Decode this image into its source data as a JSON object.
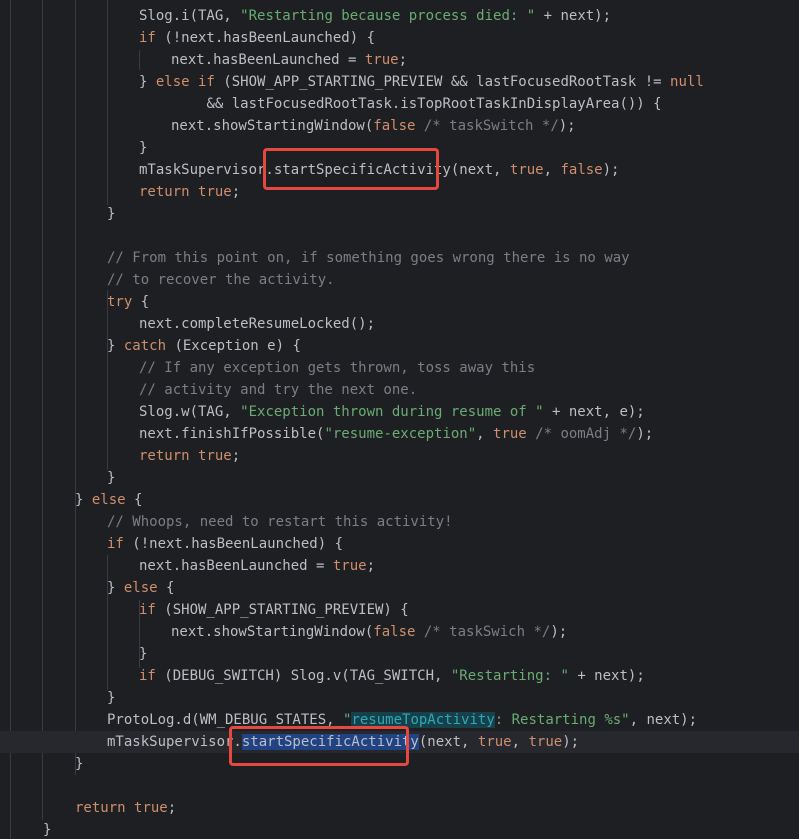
{
  "editor": {
    "lines": [
      {
        "indent": 2,
        "segs": [
          [
            "Slog.i(TAG, ",
            "plain"
          ],
          [
            "\"Restarting because process died: \"",
            "str"
          ],
          [
            " + next);",
            "plain"
          ]
        ]
      },
      {
        "indent": 2,
        "segs": [
          [
            "if",
            "kw"
          ],
          [
            " (!next.hasBeenLaunched) {",
            "plain"
          ]
        ]
      },
      {
        "indent": 3,
        "segs": [
          [
            "next.hasBeenLaunched = ",
            "plain"
          ],
          [
            "true",
            "kw"
          ],
          [
            ";",
            "plain"
          ]
        ]
      },
      {
        "indent": 2,
        "segs": [
          [
            "} ",
            "plain"
          ],
          [
            "else if",
            "kw"
          ],
          [
            " (SHOW_APP_STARTING_PREVIEW && lastFocusedRootTask != ",
            "plain"
          ],
          [
            "null",
            "kw"
          ]
        ]
      },
      {
        "indent": 2,
        "pad": "        ",
        "segs": [
          [
            "&& lastFocusedRootTask.isTopRootTaskInDisplayArea()) {",
            "plain"
          ]
        ]
      },
      {
        "indent": 3,
        "segs": [
          [
            "next.showStartingWindow(",
            "plain"
          ],
          [
            "false",
            "kw"
          ],
          [
            " /* taskSwitch */",
            "cm"
          ],
          [
            ");",
            "plain"
          ]
        ]
      },
      {
        "indent": 2,
        "segs": [
          [
            "}",
            "plain"
          ]
        ]
      },
      {
        "indent": 2,
        "segs": [
          [
            "mTaskSupervisor.",
            "plain"
          ],
          [
            "startSpecificActivity",
            "plain"
          ],
          [
            "(next, ",
            "plain"
          ],
          [
            "true",
            "kw"
          ],
          [
            ", ",
            "plain"
          ],
          [
            "false",
            "kw"
          ],
          [
            ");",
            "plain"
          ]
        ]
      },
      {
        "indent": 2,
        "segs": [
          [
            "return",
            "kw"
          ],
          [
            " ",
            "plain"
          ],
          [
            "true",
            "kw"
          ],
          [
            ";",
            "plain"
          ]
        ]
      },
      {
        "indent": 1,
        "segs": [
          [
            "}",
            "plain"
          ]
        ]
      },
      {
        "indent": 0,
        "segs": []
      },
      {
        "indent": 1,
        "segs": [
          [
            "// From this point on, if something goes wrong there is no way",
            "cm"
          ]
        ]
      },
      {
        "indent": 1,
        "segs": [
          [
            "// to recover the activity.",
            "cm"
          ]
        ]
      },
      {
        "indent": 1,
        "segs": [
          [
            "try",
            "kw"
          ],
          [
            " {",
            "plain"
          ]
        ]
      },
      {
        "indent": 2,
        "segs": [
          [
            "next.completeResumeLocked();",
            "plain"
          ]
        ]
      },
      {
        "indent": 1,
        "segs": [
          [
            "} ",
            "plain"
          ],
          [
            "catch",
            "kw"
          ],
          [
            " (Exception e) {",
            "plain"
          ]
        ]
      },
      {
        "indent": 2,
        "segs": [
          [
            "// If any exception gets thrown, toss away this",
            "cm"
          ]
        ]
      },
      {
        "indent": 2,
        "segs": [
          [
            "// activity and try the next one.",
            "cm"
          ]
        ]
      },
      {
        "indent": 2,
        "segs": [
          [
            "Slog.w(TAG, ",
            "plain"
          ],
          [
            "\"Exception thrown during resume of \"",
            "str"
          ],
          [
            " + next, e);",
            "plain"
          ]
        ]
      },
      {
        "indent": 2,
        "segs": [
          [
            "next.finishIfPossible(",
            "plain"
          ],
          [
            "\"resume-exception\"",
            "str"
          ],
          [
            ", ",
            "plain"
          ],
          [
            "true",
            "kw"
          ],
          [
            " /* oomAdj */",
            "cm"
          ],
          [
            ");",
            "plain"
          ]
        ]
      },
      {
        "indent": 2,
        "segs": [
          [
            "return",
            "kw"
          ],
          [
            " ",
            "plain"
          ],
          [
            "true",
            "kw"
          ],
          [
            ";",
            "plain"
          ]
        ]
      },
      {
        "indent": 1,
        "segs": [
          [
            "}",
            "plain"
          ]
        ]
      },
      {
        "indent": 0,
        "segs": [
          [
            "} ",
            "plain"
          ],
          [
            "else",
            "kw"
          ],
          [
            " {",
            "plain"
          ]
        ]
      },
      {
        "indent": 1,
        "segs": [
          [
            "// Whoops, need to restart this activity!",
            "cm"
          ]
        ]
      },
      {
        "indent": 1,
        "segs": [
          [
            "if",
            "kw"
          ],
          [
            " (!next.hasBeenLaunched) {",
            "plain"
          ]
        ]
      },
      {
        "indent": 2,
        "segs": [
          [
            "next.hasBeenLaunched = ",
            "plain"
          ],
          [
            "true",
            "kw"
          ],
          [
            ";",
            "plain"
          ]
        ]
      },
      {
        "indent": 1,
        "segs": [
          [
            "} ",
            "plain"
          ],
          [
            "else",
            "kw"
          ],
          [
            " {",
            "plain"
          ]
        ]
      },
      {
        "indent": 2,
        "segs": [
          [
            "if",
            "kw"
          ],
          [
            " (SHOW_APP_STARTING_PREVIEW) {",
            "plain"
          ]
        ]
      },
      {
        "indent": 3,
        "segs": [
          [
            "next.showStartingWindow(",
            "plain"
          ],
          [
            "false",
            "kw"
          ],
          [
            " /* taskSwich */",
            "cm"
          ],
          [
            ");",
            "plain"
          ]
        ]
      },
      {
        "indent": 2,
        "segs": [
          [
            "}",
            "plain"
          ]
        ]
      },
      {
        "indent": 2,
        "segs": [
          [
            "if",
            "kw"
          ],
          [
            " (DEBUG_SWITCH) Slog.v(TAG_SWITCH, ",
            "plain"
          ],
          [
            "\"Restarting: \"",
            "str"
          ],
          [
            " + next);",
            "plain"
          ]
        ]
      },
      {
        "indent": 1,
        "segs": [
          [
            "}",
            "plain"
          ]
        ]
      },
      {
        "indent": 1,
        "segs": [
          [
            "ProtoLog.d(WM_DEBUG_STATES, ",
            "plain"
          ],
          [
            "\"",
            "str"
          ],
          [
            "resumeTopActivity",
            "hl-tpl"
          ],
          [
            ": Restarting %s\"",
            "str"
          ],
          [
            ", next);",
            "plain"
          ]
        ]
      },
      {
        "indent": 1,
        "current": true,
        "segs": [
          [
            "mTaskSupervisor.",
            "plain"
          ],
          [
            "startSpecificActivity",
            "hl-usage"
          ],
          [
            "(next, ",
            "plain"
          ],
          [
            "true",
            "kw"
          ],
          [
            ", ",
            "plain"
          ],
          [
            "true",
            "kw"
          ],
          [
            ");",
            "plain"
          ]
        ]
      },
      {
        "indent": 0,
        "segs": [
          [
            "}",
            "plain"
          ]
        ]
      },
      {
        "indent": 0,
        "segs": []
      },
      {
        "indent": 0,
        "segs": [
          [
            "return",
            "kw"
          ],
          [
            " ",
            "plain"
          ],
          [
            "true",
            "kw"
          ],
          [
            ";",
            "plain"
          ]
        ]
      },
      {
        "indent": -1,
        "segs": [
          [
            "}",
            "plain"
          ]
        ]
      }
    ]
  },
  "colors": {
    "background": "#1e1f22",
    "keyword": "#cf8e6d",
    "string": "#6aab73",
    "comment": "#7a7e85",
    "annotation_box": "#e4483f",
    "usage_highlight": "#214283"
  }
}
